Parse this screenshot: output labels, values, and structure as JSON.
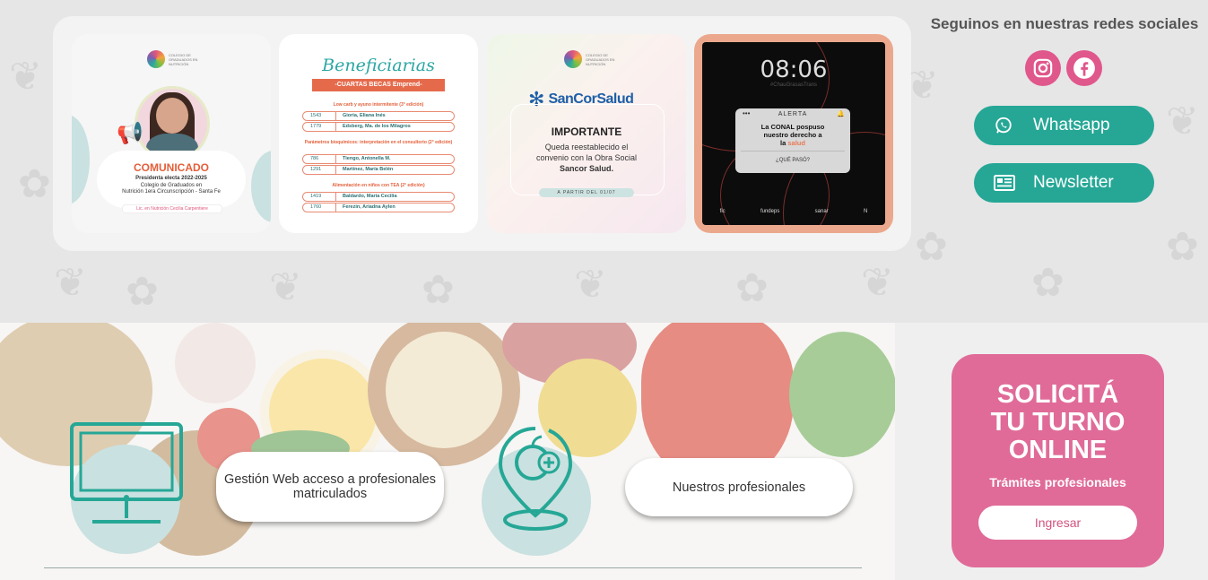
{
  "instagram": {
    "post1": {
      "logo_text": "COLEGIO DE GRADUADOS EN NUTRICIÓN",
      "heading": "COMUNICADO",
      "line1": "Presidenta electa 2022-2025",
      "line2": "Colegio de Graduados en",
      "line3": "Nutrición 1era Circunscripción - Santa Fe",
      "footer": "Lic. en Nutrición Cecilia Carpentiere"
    },
    "post2": {
      "title": "Beneficiarias",
      "tag": "-CUARTAS BECAS Emprend-",
      "sections": [
        {
          "title": "Low carb y ayuno intermitente (3° edición)",
          "rows": [
            {
              "num": "1543",
              "name": "Gioria, Eliana Inés"
            },
            {
              "num": "1779",
              "name": "Edsberg, Ma. de los Milagros"
            }
          ]
        },
        {
          "title": "Parámetros bioquímicos: interpretación en el consultorio (2° edición)",
          "rows": [
            {
              "num": "786",
              "name": "Tiengo, Antonella M."
            },
            {
              "num": "1291",
              "name": "Martínez, María Belén"
            }
          ]
        },
        {
          "title": "Alimentación en niños con TEA (2° edición)",
          "rows": [
            {
              "num": "1419",
              "name": "Baldardo, María Cecilia"
            },
            {
              "num": "1760",
              "name": "Ferezin, Ariadna Aylen"
            }
          ]
        }
      ]
    },
    "post3": {
      "logo_text": "COLEGIO DE GRADUADOS EN NUTRICIÓN",
      "brand": "SanCorSalud",
      "heading": "IMPORTANTE",
      "line1": "Queda reestablecido el",
      "line2": "convenio con la Obra Social",
      "line3": "Sancor Salud.",
      "pill": "A PARTIR DEL 01/07"
    },
    "post4": {
      "clock": "08:06",
      "hashtag": "#ChauGrasasTrans",
      "alert_title": "ALERTA",
      "alert_line1": "La CONAL pospuso",
      "alert_line2": "nuestro derecho a",
      "alert_prefix": "la",
      "alert_highlight": "salud",
      "alert_question": "¿QUÉ PASÓ?",
      "logos": [
        "fic",
        "fundeps",
        "sanar",
        "N"
      ]
    }
  },
  "social": {
    "title": "Seguinos en nuestras redes sociales",
    "whatsapp_label": "Whatsapp",
    "newsletter_label": "Newsletter"
  },
  "links": {
    "gestion_line1": "Gestión Web acceso a profesionales",
    "gestion_line2": "matriculados",
    "profesionales": "Nuestros profesionales"
  },
  "cta": {
    "line1": "SOLICITÁ",
    "line2": "TU TURNO",
    "line3": "ONLINE",
    "subtitle": "Trámites profesionales",
    "button": "Ingresar"
  },
  "colors": {
    "teal": "#26a796",
    "pink": "#e06b98",
    "social_pink": "#e0578c"
  }
}
